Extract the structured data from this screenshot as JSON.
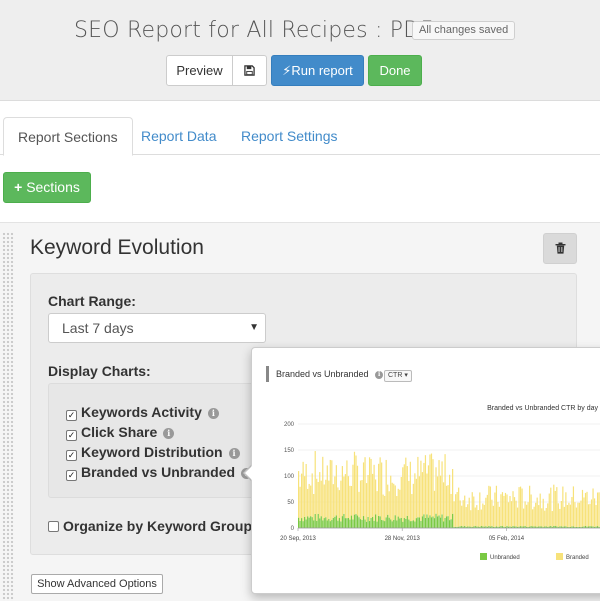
{
  "header": {
    "title": "SEO Report for All Recipes : PDF",
    "saved_status": "All changes saved",
    "preview_label": "Preview",
    "save_icon": "floppy-disk-icon",
    "run_label": "Run report",
    "done_label": "Done"
  },
  "tabs": [
    {
      "label": "Report Sections",
      "active": true
    },
    {
      "label": "Report Data",
      "active": false
    },
    {
      "label": "Report Settings",
      "active": false
    }
  ],
  "add_sections_label": "Sections",
  "section": {
    "title": "Keyword Evolution",
    "chart_range_label": "Chart Range:",
    "chart_range_value": "Last 7 days",
    "display_charts_label": "Display Charts:",
    "charts": [
      {
        "label": "Keywords Activity",
        "checked": true
      },
      {
        "label": "Click Share",
        "checked": true
      },
      {
        "label": "Keyword Distribution",
        "checked": true
      },
      {
        "label": "Branded vs Unbranded",
        "checked": true
      }
    ],
    "organize_label": "Organize by Keyword Groups",
    "organize_checked": false,
    "advanced_label": "Show Advanced Options"
  },
  "popover": {
    "heading": "Branded vs Unbranded",
    "metric_button": "CTR"
  },
  "colors": {
    "primary": "#428bca",
    "success": "#5cb85c",
    "unbranded": "#7ac943",
    "branded": "#f7e27a"
  },
  "chart_data": {
    "type": "bar",
    "title": "Branded vs Unbranded CTR by day",
    "ylim": [
      0,
      200
    ],
    "y_ticks": [
      0,
      50,
      100,
      150,
      200
    ],
    "x_tick_labels": [
      "20 Sep, 2013",
      "28 Nov, 2013",
      "05 Feb, 2014"
    ],
    "stacked": true,
    "series": [
      {
        "name": "Unbranded",
        "color": "#7ac943",
        "segments": [
          {
            "from_day": 0,
            "to_day": 103,
            "mean": 20
          },
          {
            "from_day": 103,
            "to_day": 200,
            "mean": 3
          }
        ]
      },
      {
        "name": "Branded",
        "color": "#f7e27a",
        "segments": [
          {
            "from_day": 0,
            "to_day": 103,
            "mean": 85
          },
          {
            "from_day": 103,
            "to_day": 200,
            "mean": 55
          }
        ]
      }
    ]
  }
}
